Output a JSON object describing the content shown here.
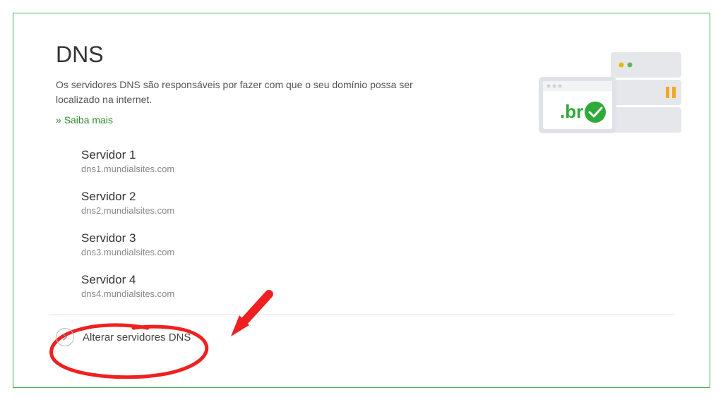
{
  "header": {
    "title": "DNS",
    "description": "Os servidores DNS são responsáveis por fazer com que o seu domínio possa ser localizado na internet.",
    "learn_more_prefix": "» ",
    "learn_more": "Saiba mais"
  },
  "servers": [
    {
      "label": "Servidor 1",
      "value": "dns1.mundialsites.com"
    },
    {
      "label": "Servidor 2",
      "value": "dns2.mundialsites.com"
    },
    {
      "label": "Servidor 3",
      "value": "dns3.mundialsites.com"
    },
    {
      "label": "Servidor 4",
      "value": "dns4.mundialsites.com"
    }
  ],
  "action": {
    "label": "Alterar servidores DNS"
  },
  "illustration": {
    "br_label": ".br"
  },
  "colors": {
    "accent": "#4caf50",
    "annotation": "#f02020"
  }
}
